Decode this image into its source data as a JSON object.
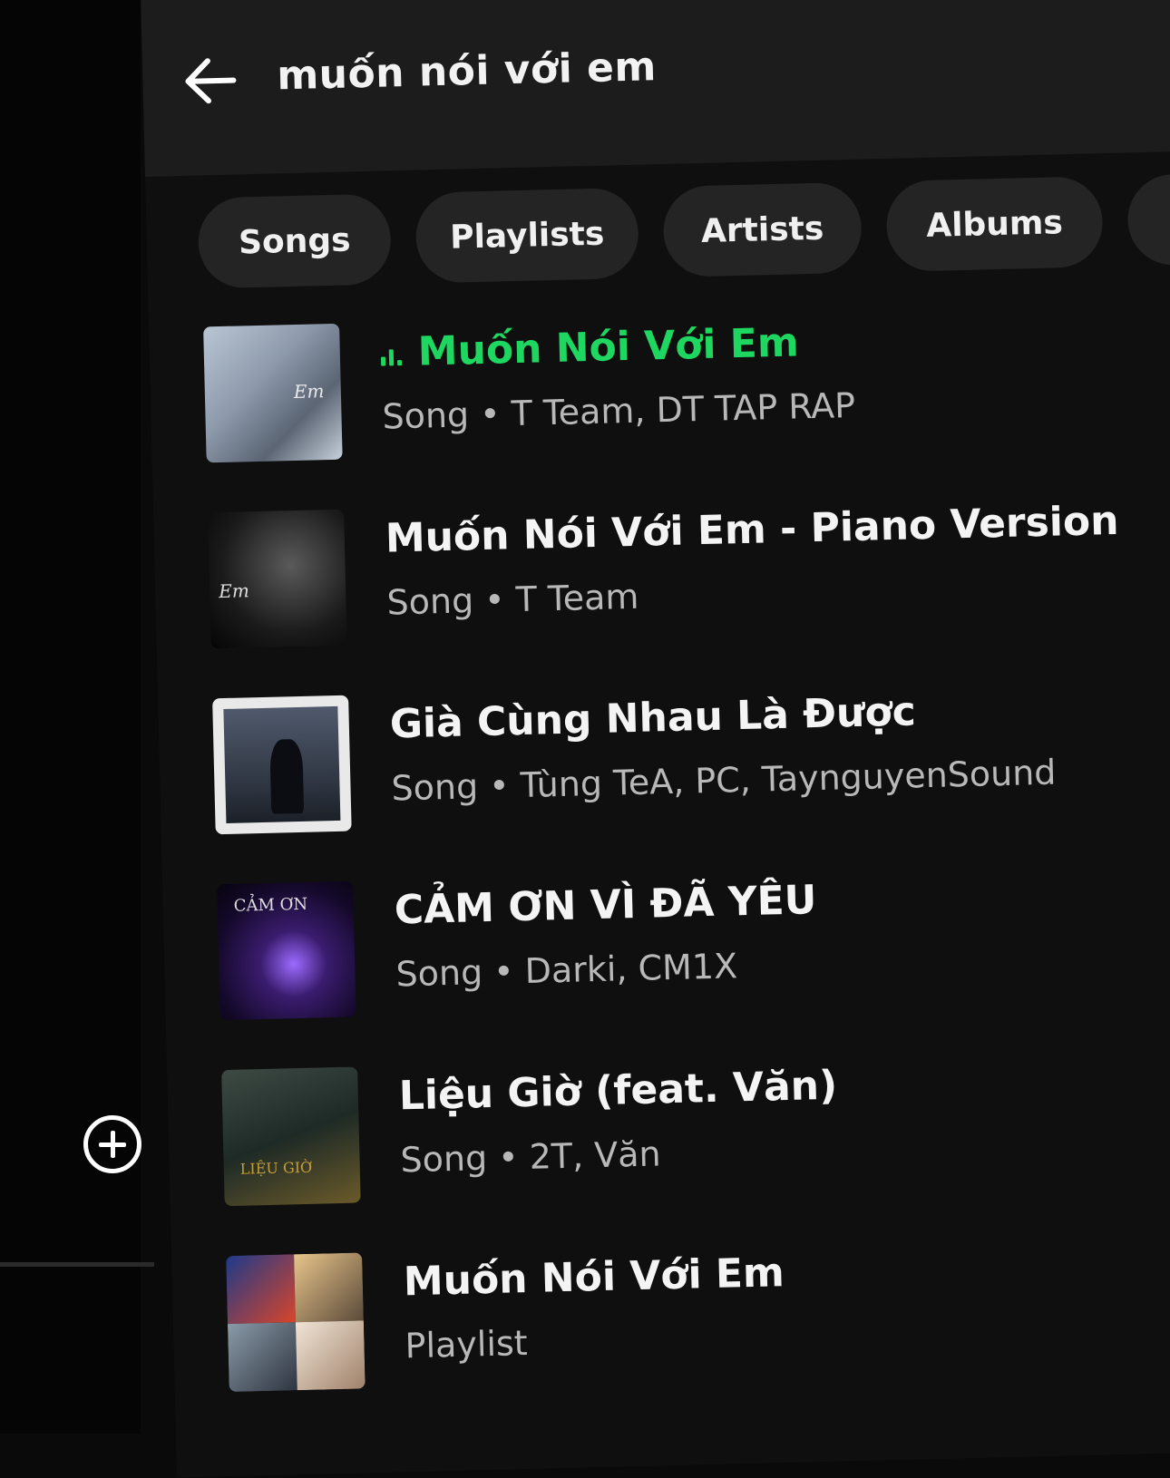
{
  "search": {
    "query": "muốn nói với em"
  },
  "filters": [
    "Songs",
    "Playlists",
    "Artists",
    "Albums"
  ],
  "results": [
    {
      "title": "Muốn Nói Với Em",
      "subtitle": "Song • T Team, DT TAP RAP",
      "playing": true
    },
    {
      "title": "Muốn Nói Với Em - Piano Version",
      "subtitle": "Song • T Team"
    },
    {
      "title": "Già Cùng Nhau Là Được",
      "subtitle": "Song • Tùng TeA, PC, TaynguyenSound"
    },
    {
      "title": "CẢM ƠN VÌ ĐÃ YÊU",
      "subtitle": "Song • Darki, CM1X"
    },
    {
      "title": "Liệu Giờ (feat. Văn)",
      "subtitle": "Song • 2T, Văn"
    },
    {
      "title": "Muốn Nói Với Em",
      "subtitle": "Playlist"
    }
  ],
  "thumb_labels": {
    "cover1": "Em",
    "cover2": "Em",
    "cover4": "CẢM ƠN",
    "cover5": "LIỆU GIỜ"
  },
  "colors": {
    "accent": "#1ed760",
    "background": "#0f0f0f",
    "chip": "#242424"
  },
  "icons": {
    "back": "arrow-left-icon",
    "add": "plus-circle-icon",
    "playing": "equalizer-icon"
  }
}
